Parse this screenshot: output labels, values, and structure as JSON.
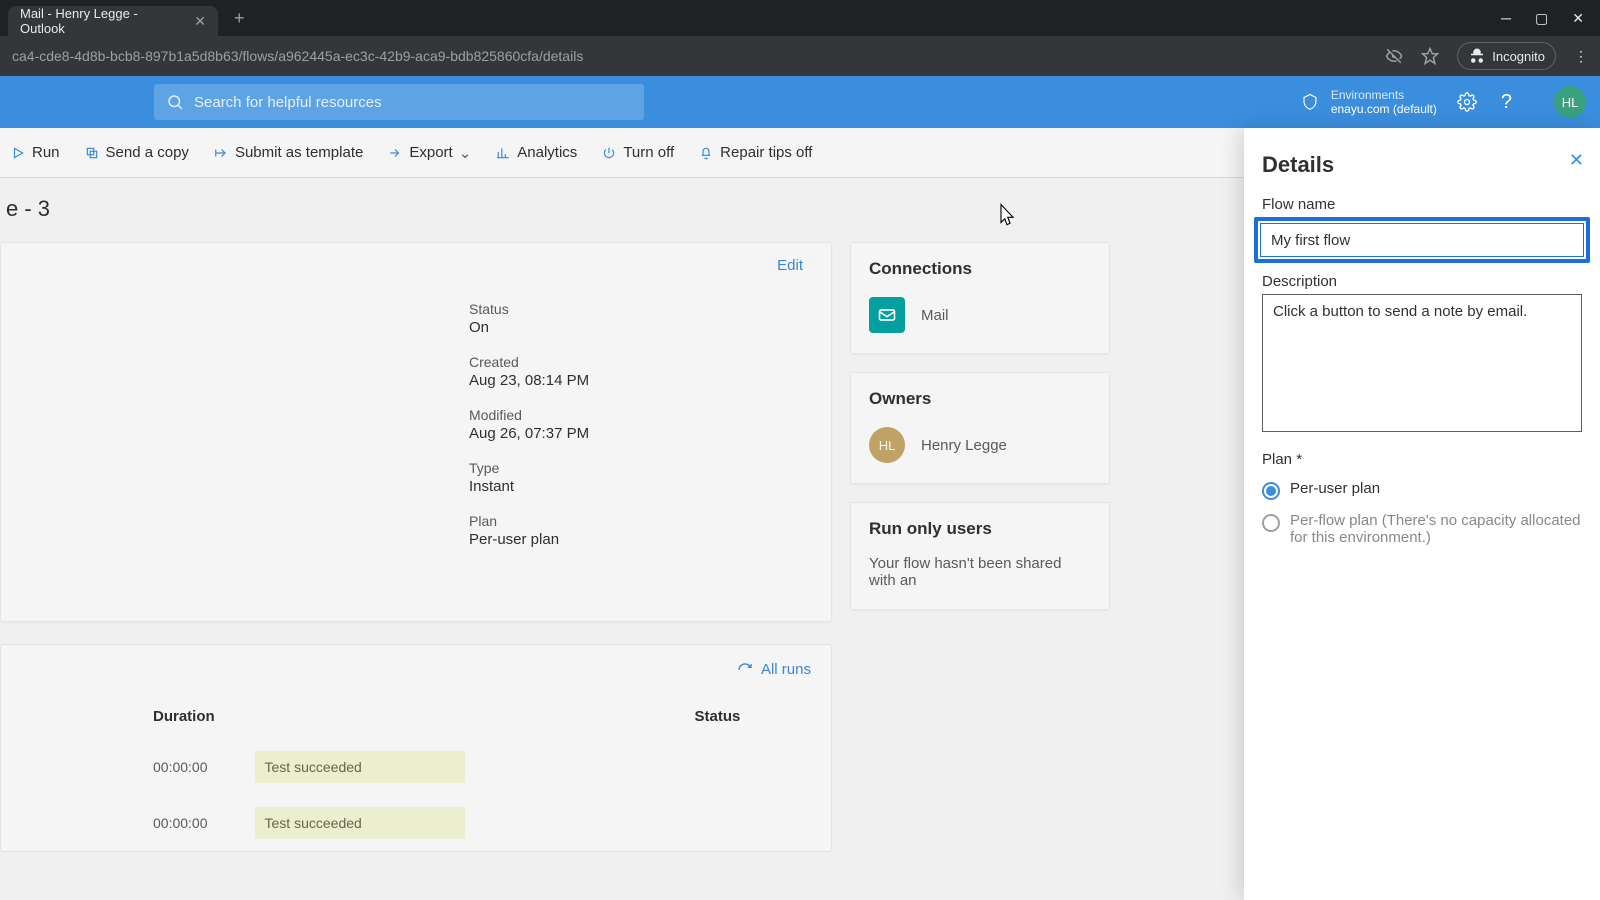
{
  "browser": {
    "tabTitle": "Mail - Henry Legge - Outlook",
    "url": "ca4-cde8-4d8b-bcb8-897b1a5d8b63/flows/a962445a-ec3c-42b9-aca9-bdb825860cfa/details",
    "incognito": "Incognito"
  },
  "appBar": {
    "searchPlaceholder": "Search for helpful resources",
    "envLabel": "Environments",
    "envValue": "enayu.com (default)",
    "avatar": "HL"
  },
  "cmd": {
    "run": "Run",
    "sendCopy": "Send a copy",
    "submit": "Submit as template",
    "export": "Export",
    "analytics": "Analytics",
    "turnOff": "Turn off",
    "repairTips": "Repair tips off"
  },
  "pageTitle": "e - 3",
  "details": {
    "edit": "Edit",
    "status": {
      "label": "Status",
      "value": "On"
    },
    "created": {
      "label": "Created",
      "value": "Aug 23, 08:14 PM"
    },
    "modified": {
      "label": "Modified",
      "value": "Aug 26, 07:37 PM"
    },
    "type": {
      "label": "Type",
      "value": "Instant"
    },
    "plan": {
      "label": "Plan",
      "value": "Per-user plan"
    }
  },
  "connections": {
    "title": "Connections",
    "items": [
      {
        "name": "Mail"
      }
    ]
  },
  "owners": {
    "title": "Owners",
    "items": [
      {
        "initials": "HL",
        "name": "Henry Legge"
      }
    ]
  },
  "runOnly": {
    "title": "Run only users",
    "body": "Your flow hasn't been shared with an"
  },
  "runHistory": {
    "allRuns": "All runs",
    "cols": {
      "duration": "Duration",
      "status": "Status"
    },
    "rows": [
      {
        "duration": "00:00:00",
        "status": "Test succeeded"
      },
      {
        "duration": "00:00:00",
        "status": "Test succeeded"
      }
    ]
  },
  "panel": {
    "title": "Details",
    "flowNameLabel": "Flow name",
    "flowNameValue": "My first flow",
    "descLabel": "Description",
    "descValue": "Click a button to send a note by email.",
    "planLabel": "Plan *",
    "perUser": "Per-user plan",
    "perFlow": "Per-flow plan (There's no capacity allocated for this environment.)"
  }
}
